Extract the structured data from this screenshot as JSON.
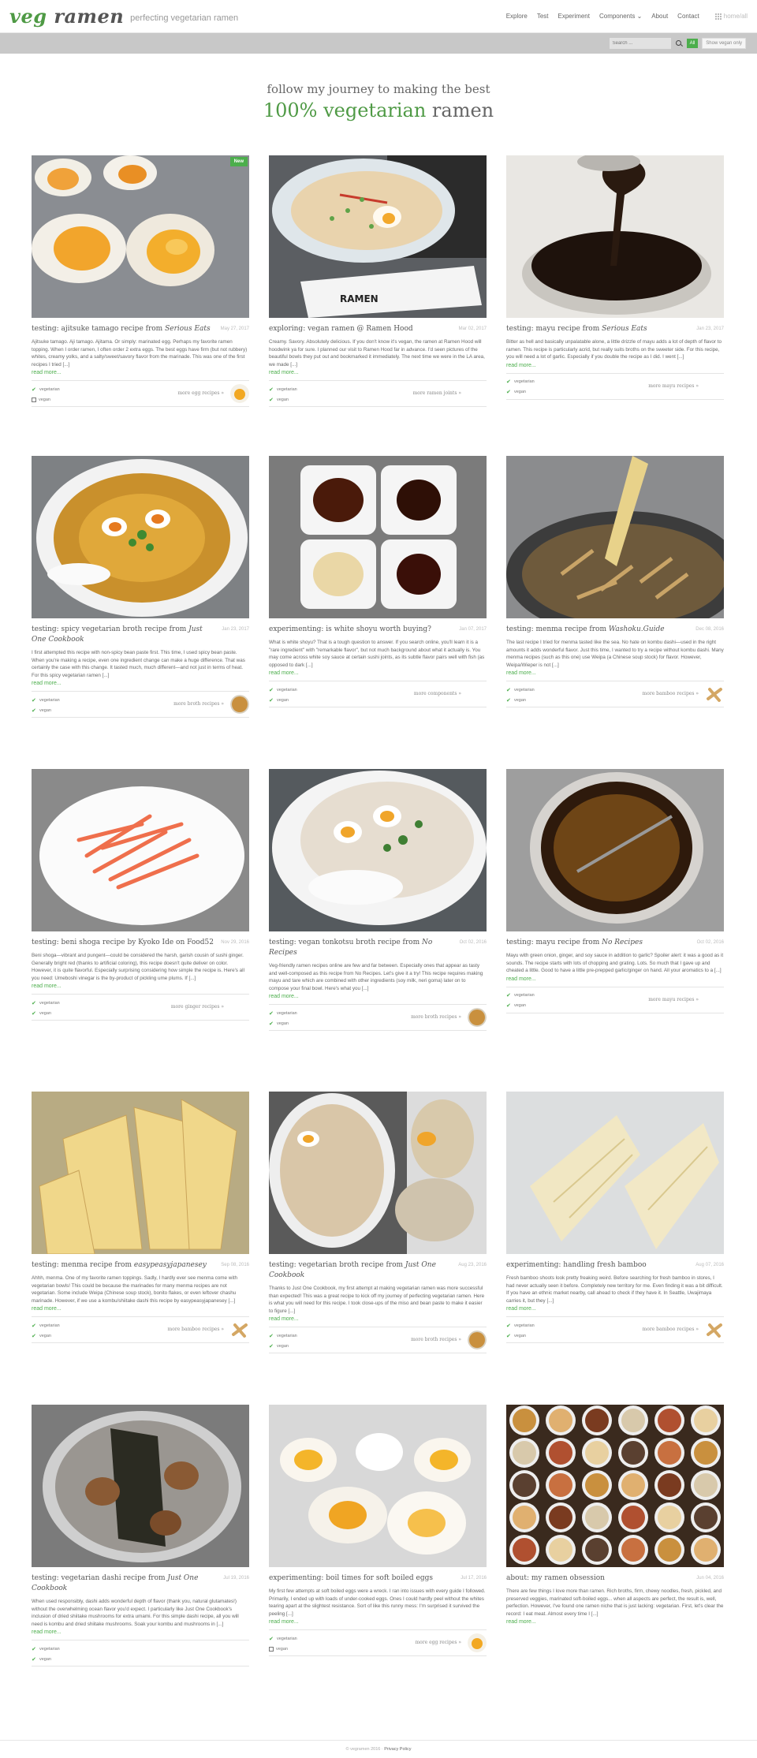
{
  "header": {
    "logo_main": "veg",
    "logo_rest": " ramen",
    "tagline": "perfecting vegetarian ramen",
    "nav": [
      "Explore",
      "Test",
      "Experiment",
      "Components",
      "About",
      "Contact"
    ],
    "home_label": "home/all"
  },
  "toolbar": {
    "search_placeholder": "Search ...",
    "all_label": "All",
    "veg_label": "Show vegan only"
  },
  "hero": {
    "line1": "follow my journey to making the best",
    "line2_pct": "100% vegetarian",
    "line2_rest": " ramen"
  },
  "cards": [
    {
      "new": "New",
      "title": "testing: ajitsuke tamago recipe from ",
      "title_em": "Serious Eats",
      "date": "May 27, 2017",
      "excerpt": "Ajitsuke tamago. Aji tamago. Ajitama. Or simply: marinated egg. Perhaps my favorite ramen topping. When I order ramen, I often order 2 extra eggs. The best eggs have firm (but not rubbery) whites, creamy yolks, and a salty/sweet/savory flavor from the marinade. This was one of the first recipes I tried [...]",
      "more": "read more...",
      "tags": [
        {
          "t": "vegetarian",
          "c": true
        },
        {
          "t": "vegan",
          "c": false
        }
      ],
      "link": "more egg recipes »",
      "thumb": "egg",
      "img": "eggs"
    },
    {
      "title": "exploring: vegan ramen @ Ramen Hood",
      "title_em": "",
      "date": "Mar 02, 2017",
      "excerpt": "Creamy. Savory. Absolutely delicious. If you don't know it's vegan, the ramen at Ramen Hood will hoodwink ya for sure. I planned our visit to Ramen Hood far in advance. I'd seen pictures of the beautiful bowls they put out and bookmarked it immediately. The next time we were in the LA area, we made [...]",
      "more": "read more...",
      "tags": [
        {
          "t": "vegetarian",
          "c": true
        },
        {
          "t": "vegan",
          "c": true
        }
      ],
      "link": "more ramen joints »",
      "thumb": "",
      "img": "bowl"
    },
    {
      "title": "testing: mayu recipe from ",
      "title_em": "Serious Eats",
      "date": "Jan 23, 2017",
      "excerpt": "Bitter as hell and basically unpalatable alone, a little drizzle of mayu adds a lot of depth of flavor to ramen. This recipe is particularly acrid, but really suits broths on the sweeter side. For this recipe, you will need a lot of garlic. Especially if you double the recipe as I did. I went [...]",
      "more": "read more...",
      "tags": [
        {
          "t": "vegetarian",
          "c": true
        },
        {
          "t": "vegan",
          "c": true
        }
      ],
      "link": "more mayu recipes »",
      "thumb": "",
      "img": "oil"
    },
    {
      "title": "testing: spicy vegetarian broth recipe from ",
      "title_em": "Just One Cookbook",
      "date": "Jan 23, 2017",
      "excerpt": "I first attempted this recipe with non-spicy bean paste first. This time, I used spicy bean paste. When you're making a recipe, even one ingredient change can make a huge difference. That was certainly the case with this change. It tasted much, much different—and not just in terms of heat. For this spicy vegetarian ramen [...]",
      "more": "read more...",
      "tags": [
        {
          "t": "vegetarian",
          "c": true
        },
        {
          "t": "vegan",
          "c": true
        }
      ],
      "link": "more broth recipes »",
      "thumb": "broth",
      "img": "spicy"
    },
    {
      "title": "experimenting: is white shoyu worth buying?",
      "title_em": "",
      "date": "Jan 07, 2017",
      "excerpt": "What is white shoyu? That is a tough question to answer. If you search online, you'll learn it is a \"rare ingredient\" with \"remarkable flavor\", but not much background about what it actually is. You may come across white soy sauce at certain sushi joints, as its subtle flavor pairs well with fish (as opposed to dark [...]",
      "more": "read more...",
      "tags": [
        {
          "t": "vegetarian",
          "c": true
        },
        {
          "t": "vegan",
          "c": true
        }
      ],
      "link": "more components »",
      "thumb": "",
      "img": "shoyu"
    },
    {
      "title": "testing: menma recipe from ",
      "title_em": "Washoku.Guide",
      "date": "Dec 08, 2016",
      "excerpt": "The last recipe I tried for menma tasted like the sea. No hate on kombu dashi—used in the right amounts it adds wonderful flavor. Just this time, I wanted to try a recipe without kombu dashi. Many menma recipes (such as this one) use Weipa (a Chinese soup stock) for flavor. However, Weipa/Wieper is not [...]",
      "more": "read more...",
      "tags": [
        {
          "t": "vegetarian",
          "c": true
        },
        {
          "t": "vegan",
          "c": true
        }
      ],
      "link": "more bamboo recipes »",
      "thumb": "bamboo",
      "img": "pot"
    },
    {
      "title": "testing: beni shoga recipe by Kyoko Ide on Food52",
      "title_em": "",
      "date": "Nov 29, 2016",
      "excerpt": "Beni shoga—vibrant and pungent—could be considered the harsh, garish cousin of sushi ginger. Generally bright red (thanks to artificial coloring), this recipe doesn't quite deliver on color. However, it is quite flavorful. Especially surprising considering how simple the recipe is. Here's all you need: Umeboshi vinegar is the by-product of pickling ume plums. If [...]",
      "more": "read more...",
      "tags": [
        {
          "t": "vegetarian",
          "c": true
        },
        {
          "t": "vegan",
          "c": true
        }
      ],
      "link": "more ginger recipes »",
      "thumb": "",
      "img": "ginger"
    },
    {
      "title": "testing: vegan tonkotsu broth recipe from ",
      "title_em": "No Recipes",
      "date": "Oct 02, 2016",
      "excerpt": "Veg-friendly ramen recipes online are few and far between. Especially ones that appear as tasty and well-composed as this recipe from No Recipes. Let's give it a try! This recipe requires making mayu and tare which are combined with other ingredients (soy milk, neri goma) later on to compose your final bowl. Here's what you [...]",
      "more": "read more...",
      "tags": [
        {
          "t": "vegetarian",
          "c": true
        },
        {
          "t": "vegan",
          "c": true
        }
      ],
      "link": "more broth recipes »",
      "thumb": "broth",
      "img": "tonkotsu"
    },
    {
      "title": "testing: mayu recipe from ",
      "title_em": "No Recipes",
      "date": "Oct 02, 2016",
      "excerpt": "Mayu with green onion, ginger, and soy sauce in addition to garlic? Spoiler alert: it was a good as it sounds. The recipe starts with lots of chopping and grating. Lots. So much that I gave up and cheated a little. Good to have a little pre-prepped garlic/ginger on hand. All your aromatics to a [...]",
      "more": "read more...",
      "tags": [
        {
          "t": "vegetarian",
          "c": true
        },
        {
          "t": "vegan",
          "c": true
        }
      ],
      "link": "more mayu recipes »",
      "thumb": "",
      "img": "jar"
    },
    {
      "title": "testing: menma recipe from ",
      "title_em": "easypeasyjapanesey",
      "date": "Sep 08, 2016",
      "excerpt": "Ahhh, menma. One of my favorite ramen toppings. Sadly, I hardly ever see menma come with vegetarian bowls! This could be because the marinades for many menma recipes are not vegetarian. Some include Weipa (Chinese soup stock), bonito flakes, or even leftover chashu marinade. However, if we use a kombu/shiitake dashi this recipe by easypeasyjapanesey [...]",
      "more": "read more...",
      "tags": [
        {
          "t": "vegetarian",
          "c": true
        },
        {
          "t": "vegan",
          "c": true
        }
      ],
      "link": "more bamboo recipes »",
      "thumb": "bamboo",
      "img": "menma"
    },
    {
      "title": "testing: vegetarian broth recipe from ",
      "title_em": "Just One Cookbook",
      "date": "Aug 23, 2016",
      "excerpt": "Thanks to Just One Cookbook, my first attempt at making vegetarian ramen was more successful than expected! This was a great recipe to kick off my journey of perfecting vegetarian ramen. Here is what you will need for this recipe. I took close-ups of the miso and bean paste to make it easier to figure [...]",
      "more": "read more...",
      "tags": [
        {
          "t": "vegetarian",
          "c": true
        },
        {
          "t": "vegan",
          "c": true
        }
      ],
      "link": "more broth recipes »",
      "thumb": "broth",
      "img": "vegbroth"
    },
    {
      "title": "experimenting: handling fresh bamboo",
      "title_em": "",
      "date": "Aug 07, 2016",
      "excerpt": "Fresh bamboo shoots look pretty freaking weird. Before searching for fresh bamboo in stores, I had never actually seen it before. Completely new territory for me. Even finding it was a bit difficult. If you have an ethnic market nearby, call ahead to check if they have it. In Seattle, Uwajimaya carries it, but they [...]",
      "more": "read more...",
      "tags": [
        {
          "t": "vegetarian",
          "c": true
        },
        {
          "t": "vegan",
          "c": true
        }
      ],
      "link": "more bamboo recipes »",
      "thumb": "bamboo",
      "img": "freshbamboo"
    },
    {
      "title": "testing: vegetarian dashi recipe from ",
      "title_em": "Just One Cookbook",
      "date": "Jul 19, 2016",
      "excerpt": "When used responsibly, dashi adds wonderful depth of flavor (thank you, natural glutamates!) without the overwhelming ocean flavor you'd expect. I particularly like Just One Cookbook's inclusion of dried shiitake mushrooms for extra umami. For this simple dashi recipe, all you will need is kombu and dried shiitake mushrooms. Soak your kombu and mushrooms in [...]",
      "more": "read more...",
      "tags": [
        {
          "t": "vegetarian",
          "c": true
        },
        {
          "t": "vegan",
          "c": true
        }
      ],
      "link": "",
      "thumb": "",
      "img": "dashi"
    },
    {
      "title": "experimenting: boil times for soft boiled eggs",
      "title_em": "",
      "date": "Jul 17, 2016",
      "excerpt": "My first few attempts at soft boiled eggs were a wreck. I ran into issues with every guide I followed. Primarily, I ended up with loads of under-cooked eggs. Ones I could hardly peel without the whites tearing apart at the slightest resistance. Sort of like this runny mess: I'm surprised it survived the peeling [...]",
      "more": "read more...",
      "tags": [
        {
          "t": "vegetarian",
          "c": true
        },
        {
          "t": "vegan",
          "c": false
        }
      ],
      "link": "more egg recipes »",
      "thumb": "egg",
      "img": "boiled"
    },
    {
      "title": "about: my ramen obsession",
      "title_em": "",
      "date": "Jun 04, 2016",
      "excerpt": "There are few things I love more than ramen. Rich broths, firm, chewy noodles, fresh, pickled, and preserved veggies, marinated soft-boiled eggs... when all aspects are perfect, the result is, well, perfection. However, I've found one ramen niche that is just lacking: vegetarian. First, let's clear the record: I eat meat. Almost every time I [...]",
      "more": "read more...",
      "tags": [],
      "link": "",
      "thumb": "",
      "img": "collage"
    }
  ],
  "footer": {
    "copy": "© vegramen 2016 ·",
    "privacy": "Privacy Policy"
  }
}
